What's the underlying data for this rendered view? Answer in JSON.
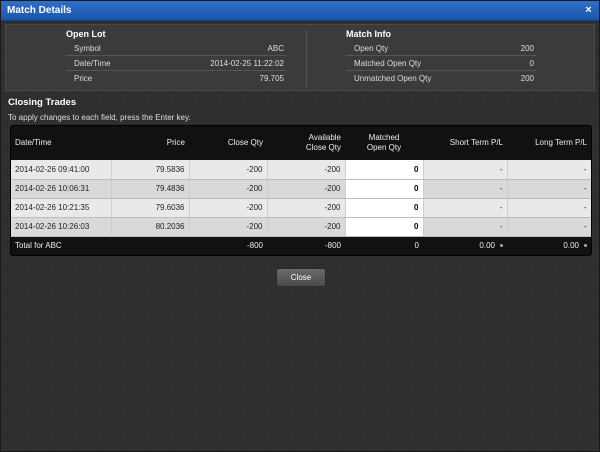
{
  "window": {
    "title": "Match Details",
    "close_glyph": "×"
  },
  "open_lot": {
    "heading": "Open Lot",
    "rows": [
      {
        "label": "Symbol",
        "value": "ABC"
      },
      {
        "label": "Date/Time",
        "value": "2014-02-25 11:22:02"
      },
      {
        "label": "Price",
        "value": "79.705"
      }
    ]
  },
  "match_info": {
    "heading": "Match Info",
    "rows": [
      {
        "label": "Open Qty",
        "value": "200"
      },
      {
        "label": "Matched Open Qty",
        "value": "0"
      },
      {
        "label": "Unmatched Open Qty",
        "value": "200"
      }
    ]
  },
  "closing_trades": {
    "title": "Closing Trades",
    "hint": "To apply changes to each field, press the Enter key.",
    "columns": {
      "datetime": "Date/Time",
      "price": "Price",
      "close_qty": "Close Qty",
      "available_1": "Available",
      "available_2": "Close Qty",
      "matched_1": "Matched",
      "matched_2": "Open Qty",
      "short_pl": "Short Term P/L",
      "long_pl": "Long Term P/L"
    },
    "rows": [
      {
        "datetime": "2014-02-26 09:41:00",
        "price": "79.5836",
        "close_qty": "-200",
        "available": "-200",
        "matched": "0",
        "short_pl": "-",
        "long_pl": "-"
      },
      {
        "datetime": "2014-02-26 10:06:31",
        "price": "79.4836",
        "close_qty": "-200",
        "available": "-200",
        "matched": "0",
        "short_pl": "-",
        "long_pl": "-"
      },
      {
        "datetime": "2014-02-26 10:21:35",
        "price": "79.6036",
        "close_qty": "-200",
        "available": "-200",
        "matched": "0",
        "short_pl": "-",
        "long_pl": "-"
      },
      {
        "datetime": "2014-02-26 10:26:03",
        "price": "80.2036",
        "close_qty": "-200",
        "available": "-200",
        "matched": "0",
        "short_pl": "-",
        "long_pl": "-"
      }
    ],
    "total": {
      "label": "Total for ABC",
      "close_qty": "-800",
      "available": "-800",
      "matched": "0",
      "short_pl": "0.00",
      "long_pl": "0.00"
    }
  },
  "buttons": {
    "close": "Close"
  },
  "colors": {
    "titlebar": "#1c55ad",
    "background": "#2d2d2d",
    "grid_header": "#111111"
  }
}
